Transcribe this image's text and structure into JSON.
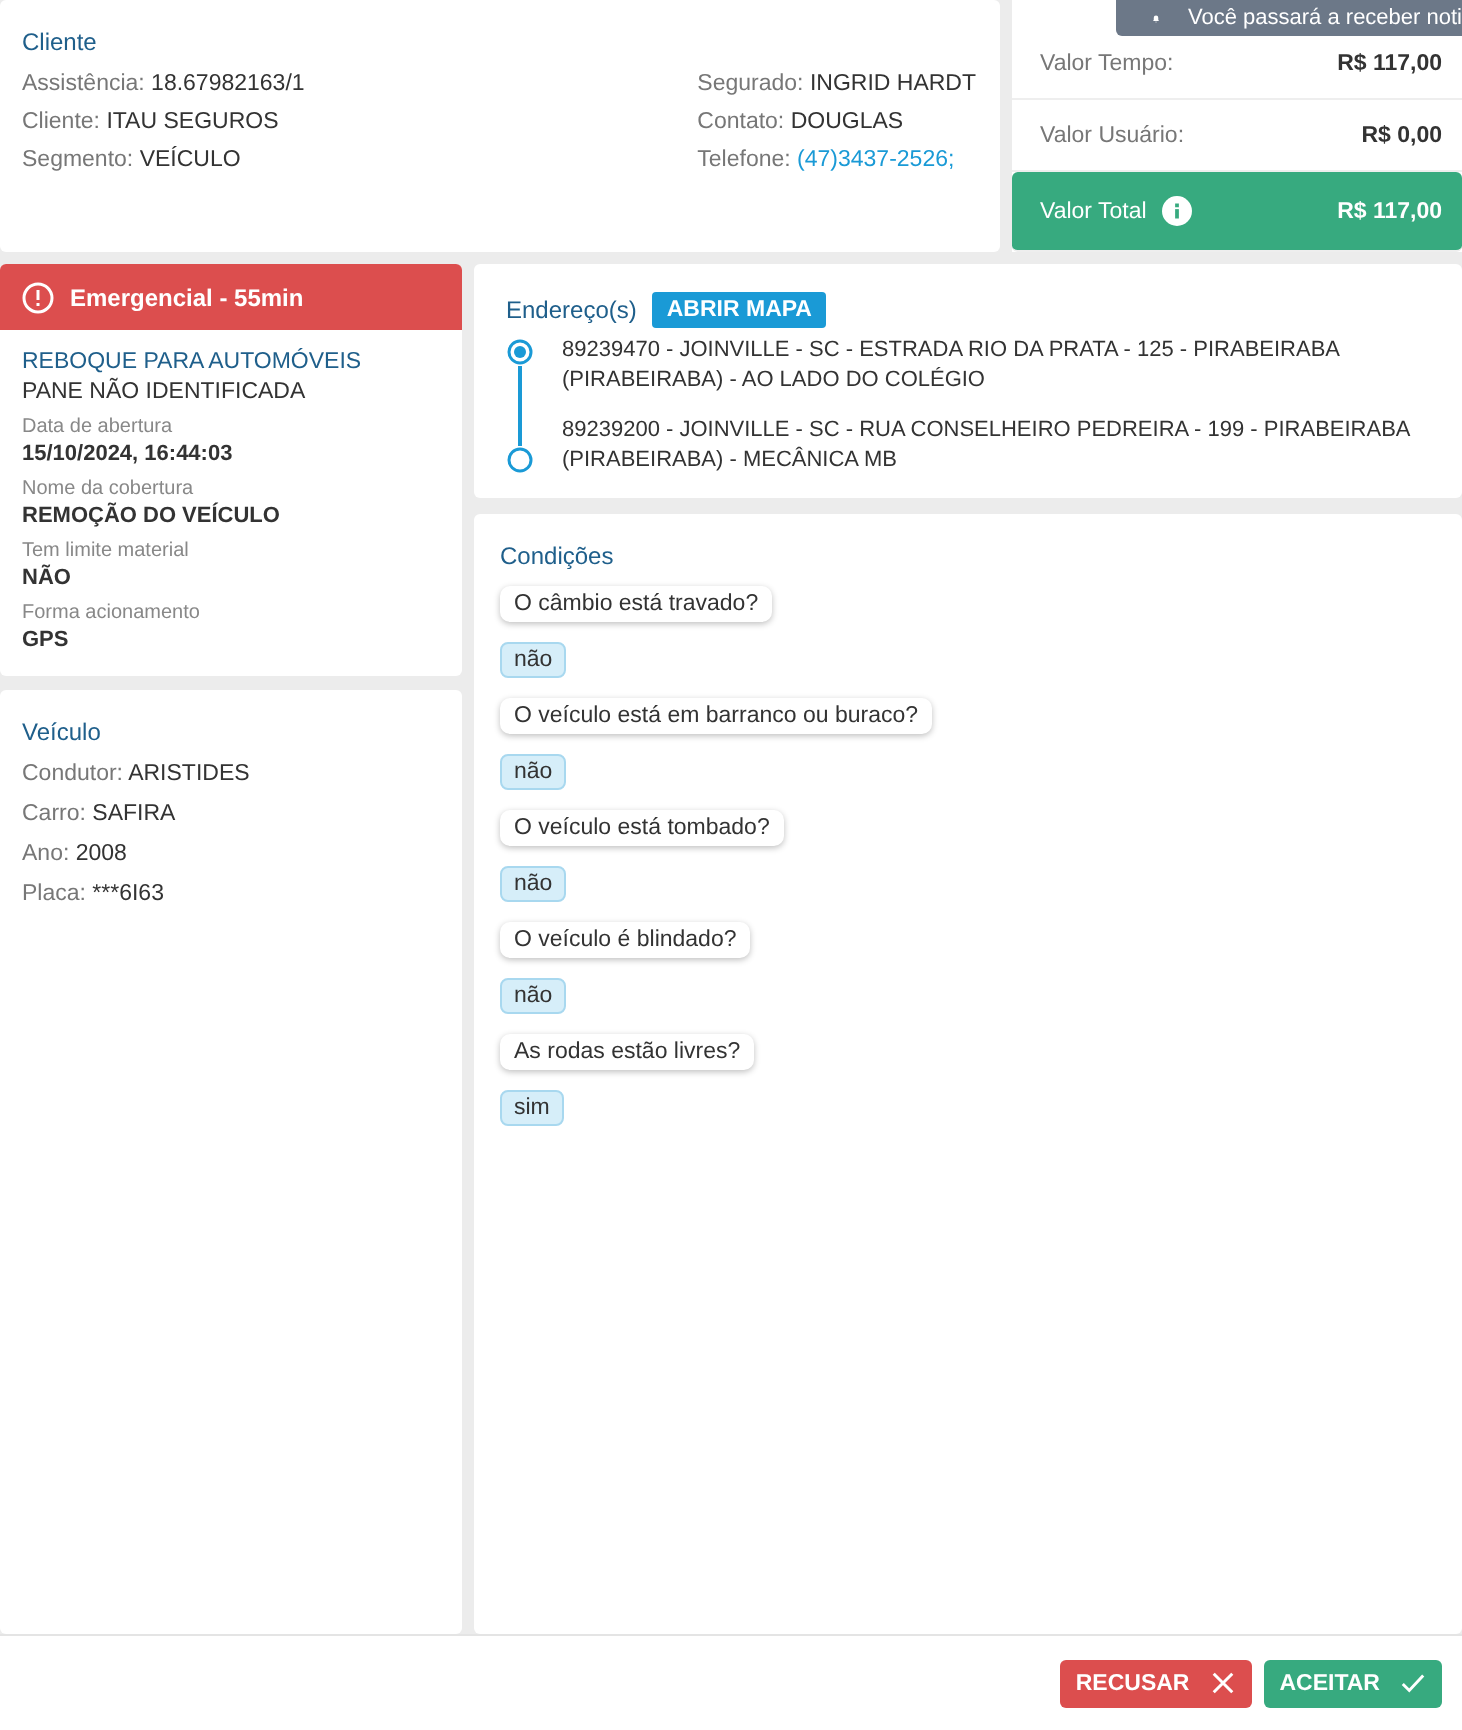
{
  "cliente": {
    "title": "Cliente",
    "left": [
      {
        "label": "Assistência:",
        "value": "18.67982163/1"
      },
      {
        "label": "Cliente:",
        "value": "ITAU SEGUROS"
      },
      {
        "label": "Segmento:",
        "value": "VEÍCULO"
      }
    ],
    "right": [
      {
        "label": "Segurado:",
        "value": "INGRID HARDT",
        "link": false
      },
      {
        "label": "Contato:",
        "value": "DOUGLAS",
        "link": false
      },
      {
        "label": "Telefone:",
        "value": "(47)3437-2526;",
        "link": true
      }
    ]
  },
  "valores": [
    {
      "label": "Valor Tempo:",
      "value": "R$ 117,00",
      "total": false
    },
    {
      "label": "Valor Usuário:",
      "value": "R$ 0,00",
      "total": false
    },
    {
      "label": "Valor Total",
      "value": "R$ 117,00",
      "total": true
    }
  ],
  "toast": {
    "text": "Você passará a receber noti"
  },
  "servico": {
    "alert": "Emergencial - 55min",
    "title": "REBOQUE PARA AUTOMÓVEIS",
    "subtitle": "PANE NÃO IDENTIFICADA",
    "fields": [
      {
        "label": "Data de abertura",
        "value": "15/10/2024, 16:44:03"
      },
      {
        "label": "Nome da cobertura",
        "value": "REMOÇÃO DO VEÍCULO"
      },
      {
        "label": "Tem limite material",
        "value": "NÃO"
      },
      {
        "label": "Forma acionamento",
        "value": "GPS"
      }
    ]
  },
  "veiculo": {
    "title": "Veículo",
    "items": [
      {
        "label": "Condutor:",
        "value": "ARISTIDES"
      },
      {
        "label": "Carro:",
        "value": "SAFIRA"
      },
      {
        "label": "Ano:",
        "value": "2008"
      },
      {
        "label": "Placa:",
        "value": "***6I63"
      }
    ]
  },
  "enderecos": {
    "title": "Endereço(s)",
    "button": "ABRIR MAPA",
    "items": [
      {
        "text": "89239470 - JOINVILLE - SC - ESTRADA RIO DA PRATA - 125 - PIRABEIRABA (PIRABEIRABA) - AO LADO DO COLÉGIO",
        "selected": true
      },
      {
        "text": "89239200 - JOINVILLE - SC - RUA CONSELHEIRO PEDREIRA - 199 - PIRABEIRABA (PIRABEIRABA) - MECÂNICA MB",
        "selected": false
      }
    ]
  },
  "condicoes": {
    "title": "Condições",
    "items": [
      {
        "question": "O câmbio está travado?",
        "answer": "não"
      },
      {
        "question": "O veículo está em barranco ou buraco?",
        "answer": "não"
      },
      {
        "question": "O veículo está tombado?",
        "answer": "não"
      },
      {
        "question": "O veículo é blindado?",
        "answer": "não"
      },
      {
        "question": "As rodas estão livres?",
        "answer": "sim"
      }
    ]
  },
  "actions": [
    {
      "label": "RECUSAR",
      "kind": "reject"
    },
    {
      "label": "ACEITAR",
      "kind": "accept"
    }
  ]
}
